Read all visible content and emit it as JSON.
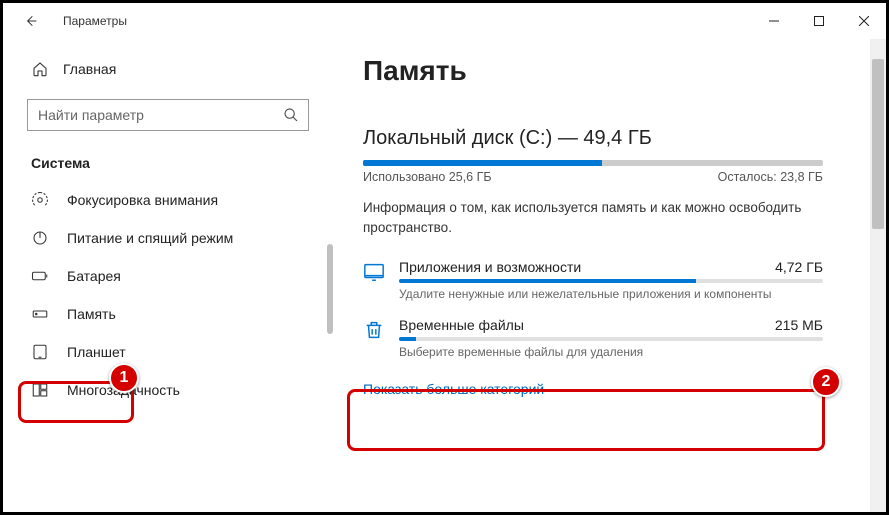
{
  "window": {
    "title": "Параметры"
  },
  "sidebar": {
    "home": "Главная",
    "search_placeholder": "Найти параметр",
    "section": "Система",
    "items": [
      {
        "label": "Фокусировка внимания"
      },
      {
        "label": "Питание и спящий режим"
      },
      {
        "label": "Батарея"
      },
      {
        "label": "Память"
      },
      {
        "label": "Планшет"
      },
      {
        "label": "Многозадачность"
      }
    ]
  },
  "main": {
    "title": "Память",
    "disk": {
      "title": "Локальный диск (C:) — 49,4 ГБ",
      "used_label": "Использовано 25,6 ГБ",
      "free_label": "Осталось: 23,8 ГБ",
      "used_pct": 52
    },
    "info": "Информация о том, как используется память и как можно освободить пространство.",
    "categories": [
      {
        "name": "Приложения и возможности",
        "size": "4,72 ГБ",
        "pct": 70,
        "desc": "Удалите ненужные или нежелательные приложения и компоненты"
      },
      {
        "name": "Временные файлы",
        "size": "215 МБ",
        "pct": 4,
        "desc": "Выберите временные файлы для удаления"
      }
    ],
    "more_link": "Показать больше категорий"
  },
  "annotations": {
    "badge1": "1",
    "badge2": "2"
  }
}
